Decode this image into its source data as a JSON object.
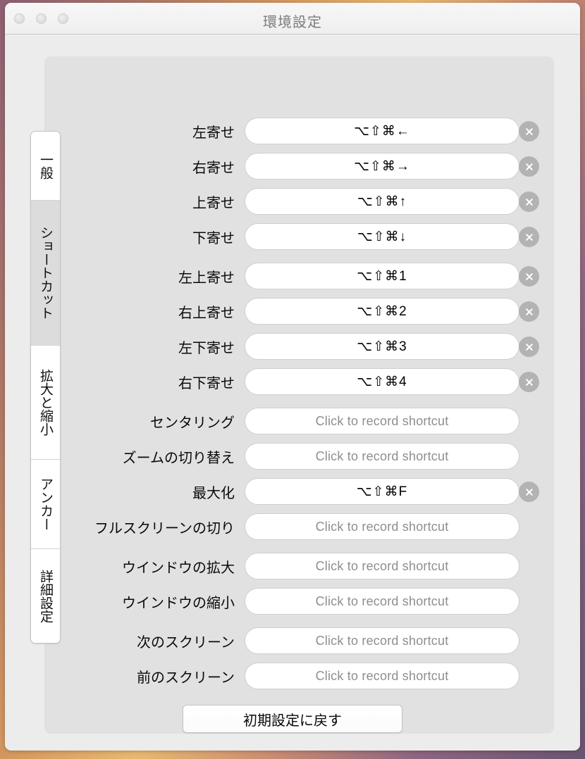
{
  "window": {
    "title": "環境設定",
    "traffic_lights": [
      "close",
      "minimize",
      "zoom"
    ]
  },
  "sidebar": {
    "items": [
      {
        "label": "一般",
        "selected": false
      },
      {
        "label": "ショートカット",
        "selected": true
      },
      {
        "label": "拡大と縮小",
        "selected": false
      },
      {
        "label": "アンカー",
        "selected": false
      },
      {
        "label": "詳細設定",
        "selected": false
      }
    ]
  },
  "main": {
    "placeholder": "Click to record shortcut",
    "clear_icon": "clear-circle-icon",
    "rows": [
      {
        "label": "左寄せ",
        "value": "⌥⇧⌘←",
        "has_value": true,
        "gap_before": false
      },
      {
        "label": "右寄せ",
        "value": "⌥⇧⌘→",
        "has_value": true,
        "gap_before": false
      },
      {
        "label": "上寄せ",
        "value": "⌥⇧⌘↑",
        "has_value": true,
        "gap_before": false
      },
      {
        "label": "下寄せ",
        "value": "⌥⇧⌘↓",
        "has_value": true,
        "gap_before": false
      },
      {
        "label": "左上寄せ",
        "value": "⌥⇧⌘1",
        "has_value": true,
        "gap_before": true
      },
      {
        "label": "右上寄せ",
        "value": "⌥⇧⌘2",
        "has_value": true,
        "gap_before": false
      },
      {
        "label": "左下寄せ",
        "value": "⌥⇧⌘3",
        "has_value": true,
        "gap_before": false
      },
      {
        "label": "右下寄せ",
        "value": "⌥⇧⌘4",
        "has_value": true,
        "gap_before": false
      },
      {
        "label": "センタリング",
        "value": "",
        "has_value": false,
        "gap_before": true
      },
      {
        "label": "ズームの切り替え",
        "value": "",
        "has_value": false,
        "gap_before": false
      },
      {
        "label": "最大化",
        "value": "⌥⇧⌘F",
        "has_value": true,
        "gap_before": false
      },
      {
        "label": "フルスクリーンの切り",
        "value": "",
        "has_value": false,
        "gap_before": false
      },
      {
        "label": "ウインドウの拡大",
        "value": "",
        "has_value": false,
        "gap_before": true
      },
      {
        "label": "ウインドウの縮小",
        "value": "",
        "has_value": false,
        "gap_before": false
      },
      {
        "label": "次のスクリーン",
        "value": "",
        "has_value": false,
        "gap_before": true
      },
      {
        "label": "前のスクリーン",
        "value": "",
        "has_value": false,
        "gap_before": false
      }
    ],
    "reset_button": "初期設定に戻す"
  },
  "colors": {
    "window_bg": "#ececec",
    "panel_bg": "#e1e1e1",
    "field_bg": "#ffffff",
    "selected_tab_bg": "#dcdcdc",
    "clear_button": "#b3b3b3",
    "title_text": "#7b7b7b",
    "placeholder_text": "#8e8e8e"
  }
}
